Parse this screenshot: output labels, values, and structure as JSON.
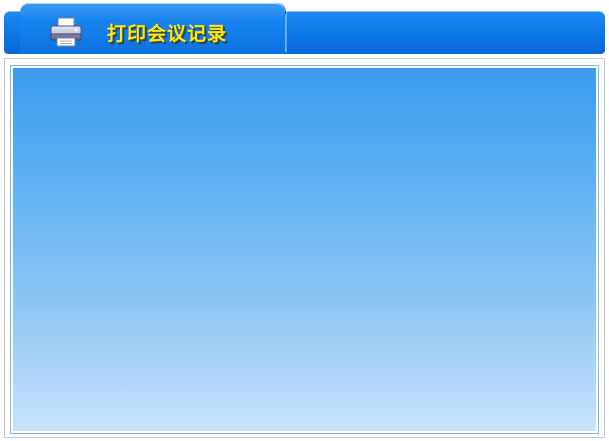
{
  "header": {
    "title": "打印会议记录",
    "icon": "printer-icon"
  },
  "colors": {
    "header_blue": "#0b76e6",
    "title_yellow": "#f8e81c",
    "panel_top": "#3b9bee",
    "panel_bottom": "#c8e3fb"
  }
}
